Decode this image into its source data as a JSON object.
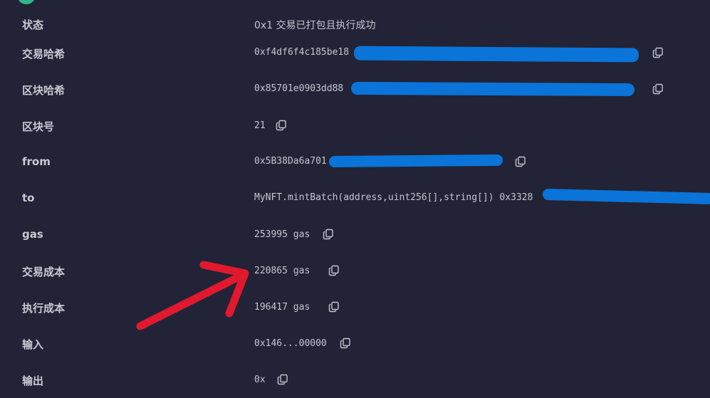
{
  "rows": [
    {
      "label": "状态",
      "value": "0x1 交易已打包且执行成功",
      "copy": false
    },
    {
      "label": "交易哈希",
      "value": "0xf4df6f4c185be18",
      "copy": true
    },
    {
      "label": "区块哈希",
      "value": "0x85701e0903dd88",
      "copy": true
    },
    {
      "label": "区块号",
      "value": "21",
      "copy": true
    },
    {
      "label": "from",
      "value": "0x5B38Da6a701",
      "copy": true
    },
    {
      "label": "to",
      "value": "MyNFT.mintBatch(address,uint256[],string[]) 0x3328",
      "copy": false
    },
    {
      "label": "gas",
      "value": "253995 gas",
      "copy": true
    },
    {
      "label": "交易成本",
      "value": "220865 gas",
      "copy": true
    },
    {
      "label": "执行成本",
      "value": "196417 gas",
      "copy": true
    },
    {
      "label": "输入",
      "value": "0x146...00000",
      "copy": true
    },
    {
      "label": "输出",
      "value": "0x",
      "copy": true
    }
  ],
  "icons": {
    "copy": "copy-icon",
    "annotation": "red-arrow-annotation"
  },
  "colors": {
    "background": "#222336",
    "text": "#c5c6cf",
    "redaction": "#0a74d8",
    "arrow": "#e0192e",
    "status_dot": "#2fb887"
  }
}
